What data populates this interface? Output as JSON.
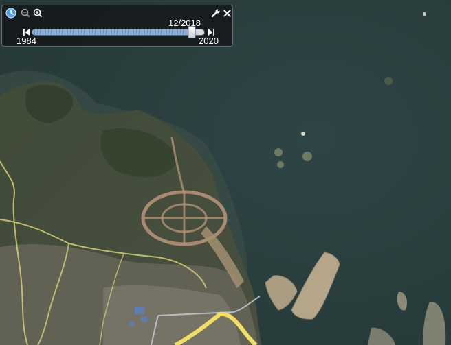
{
  "map": {
    "colors": {
      "sea": "#2d4141",
      "land": "#3f4a36",
      "roads": "#d9d27a",
      "highway": "#f2df6a",
      "reclaimed": "#b9a88a"
    }
  },
  "timebar": {
    "current_date": "12/2018",
    "start_year": "1984",
    "end_year": "2020",
    "position": 0.95,
    "icons": {
      "history": "clock-icon",
      "zoom_out": "zoom-out-icon",
      "zoom_in": "zoom-in-icon",
      "settings": "wrench-icon",
      "close": "close-icon",
      "prev": "step-back-icon",
      "next": "step-forward-icon"
    }
  }
}
